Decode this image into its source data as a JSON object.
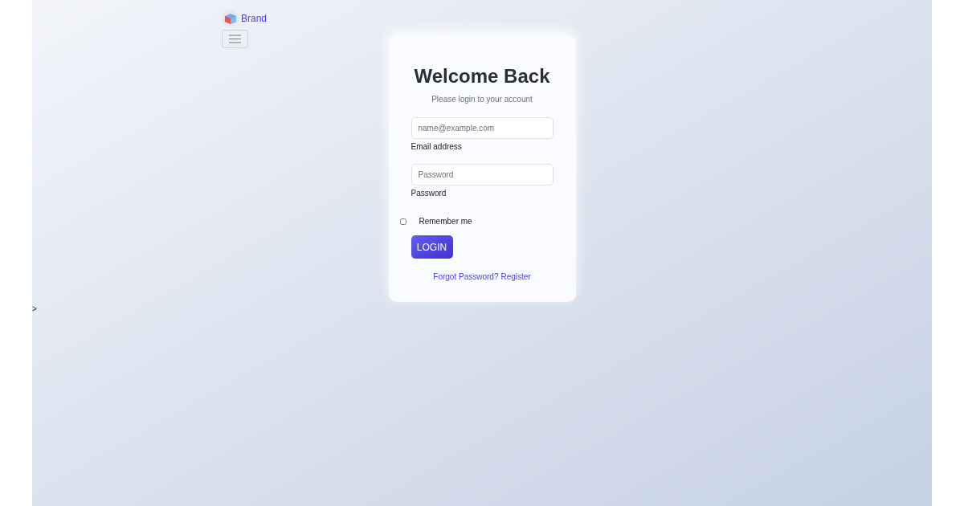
{
  "brand": {
    "name": "Brand"
  },
  "card": {
    "title": "Welcome Back",
    "subtitle": "Please login to your account",
    "fields": [
      {
        "placeholder": "name@example.com",
        "label": "Email address"
      },
      {
        "placeholder": "Password",
        "label": "Password"
      }
    ],
    "remember": {
      "label": "Remember me",
      "checked": false
    },
    "login_button": "LOGIN",
    "links": [
      "Forgot Password?",
      "Register"
    ]
  },
  "stray_text": ">"
}
